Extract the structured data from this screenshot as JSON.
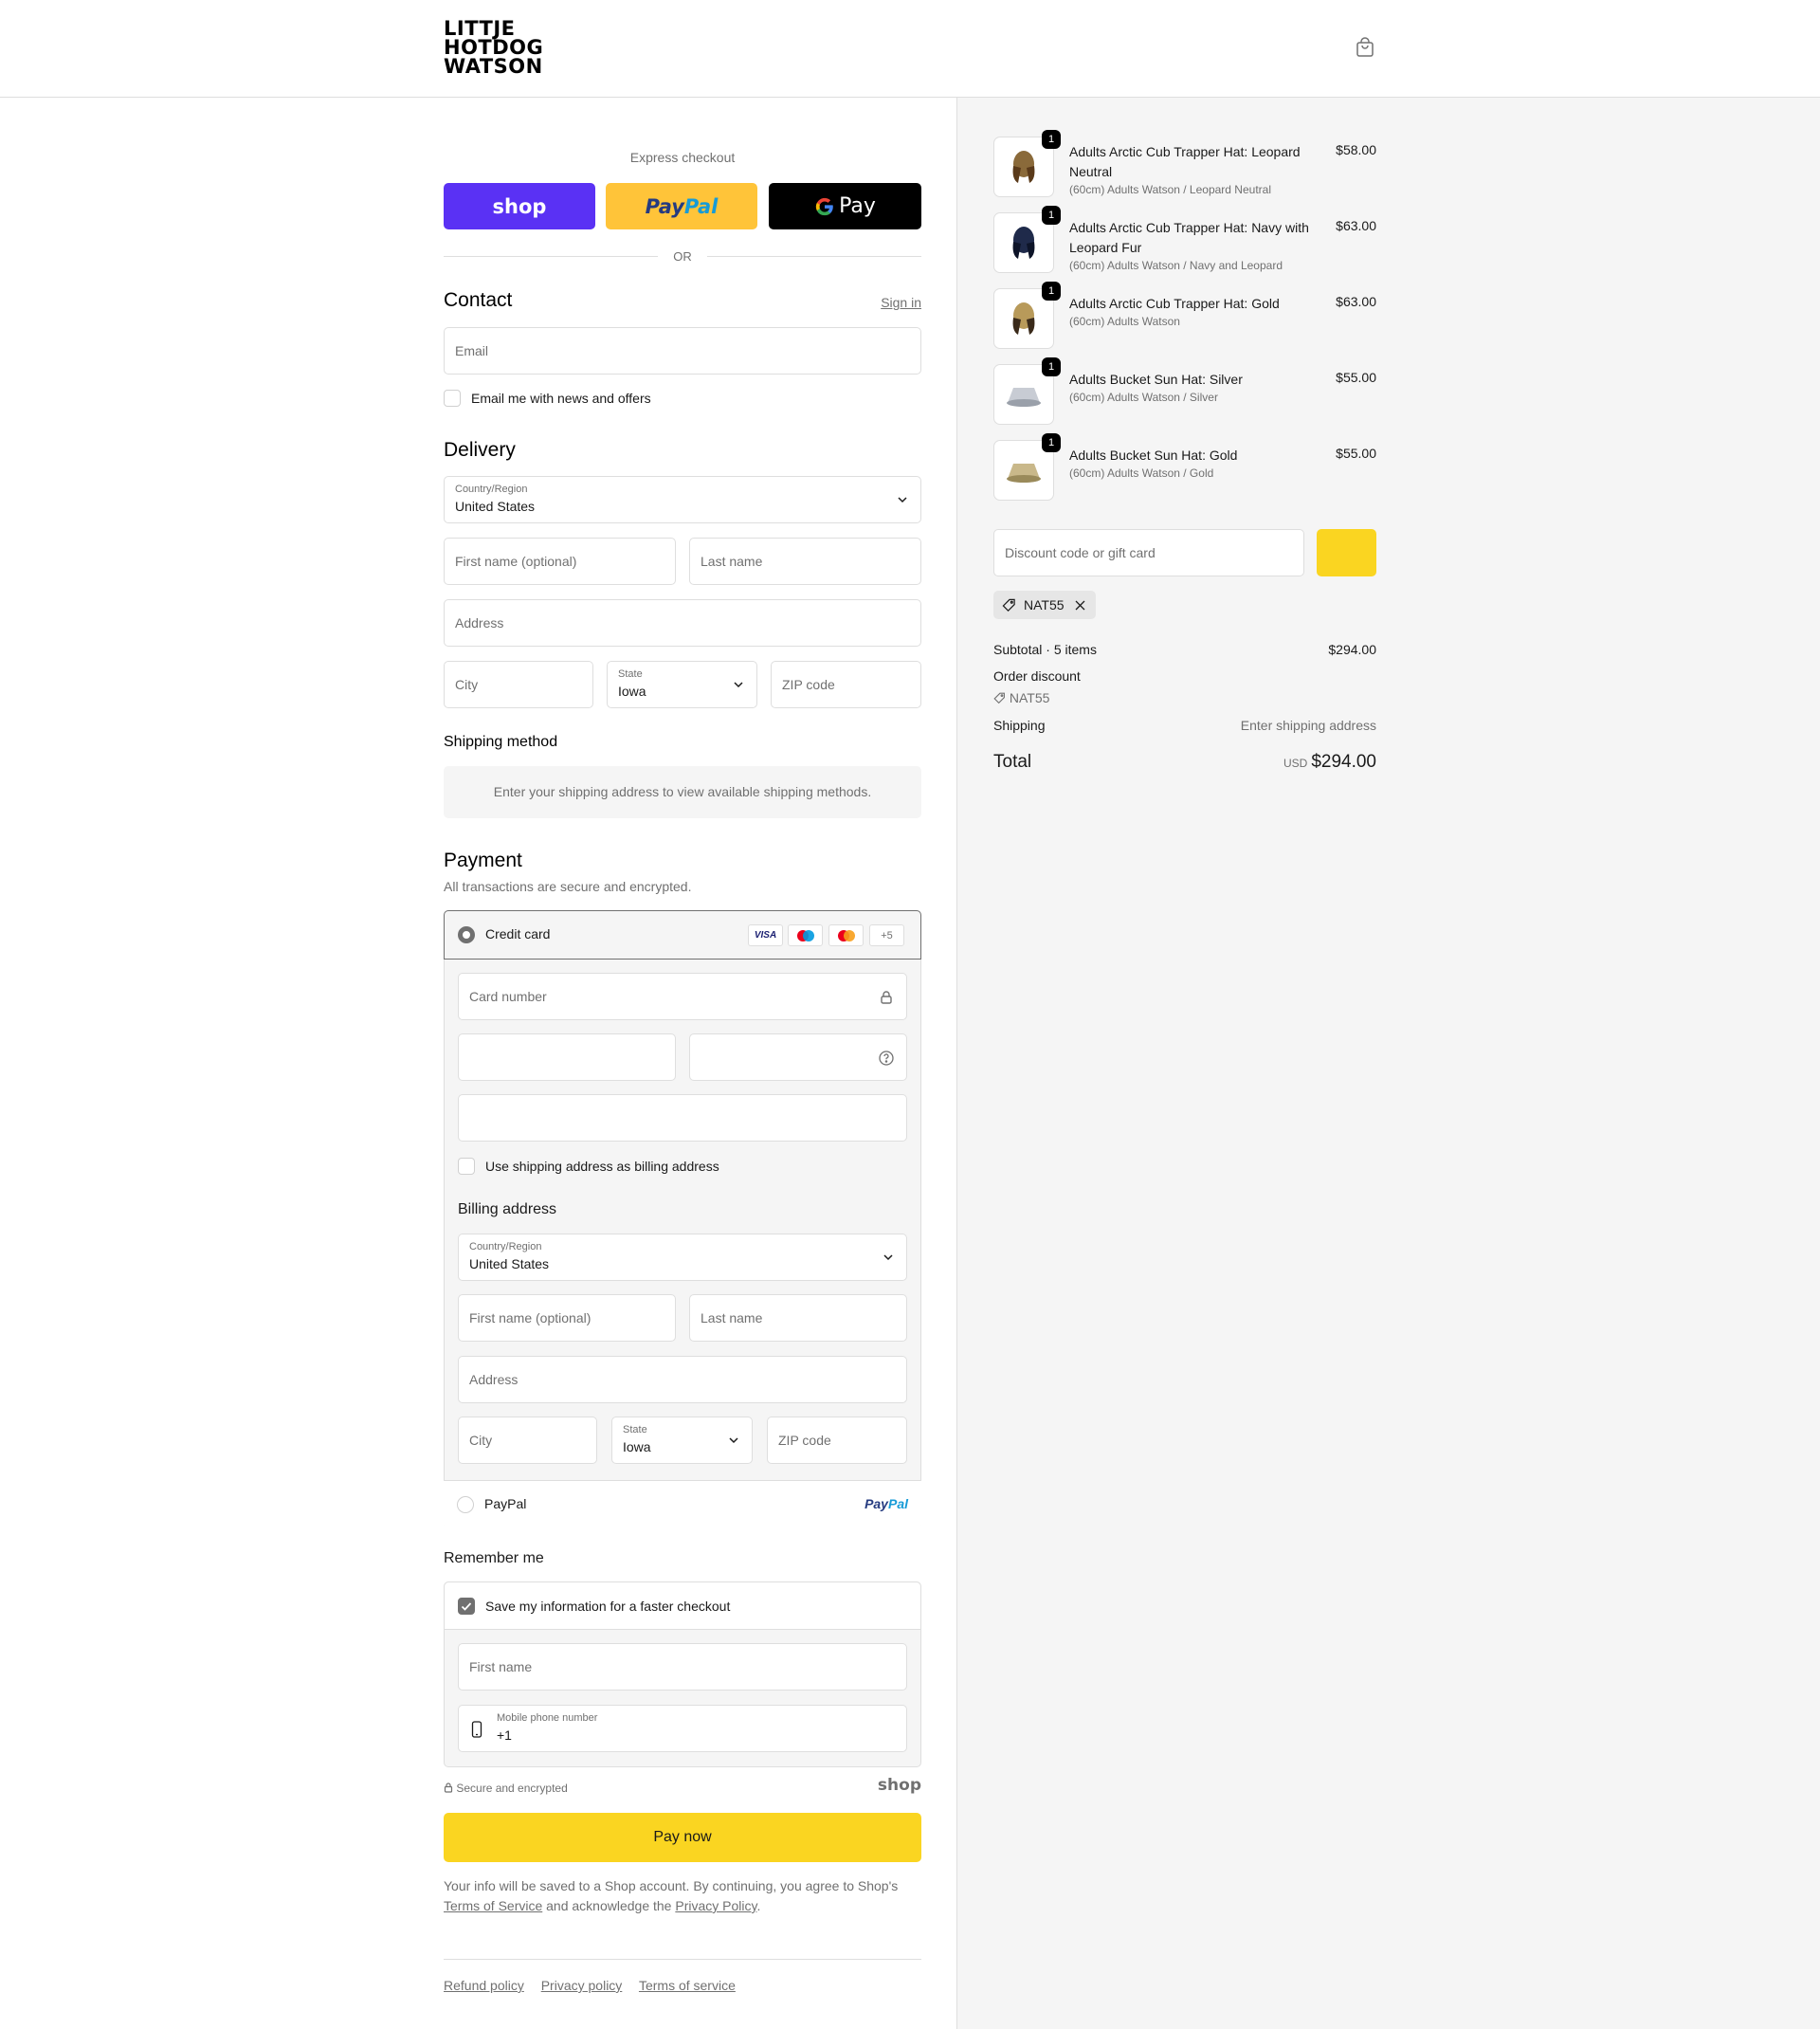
{
  "header": {
    "logo_lines": [
      "LITTJE",
      "HOTDOG",
      "WATSON"
    ],
    "cart_icon": "shopping-bag-icon"
  },
  "express": {
    "label": "Express checkout",
    "shop_label": "shop",
    "paypal_part1": "Pay",
    "paypal_part2": "Pal",
    "gpay_label": "Pay",
    "or_label": "OR"
  },
  "contact": {
    "title": "Contact",
    "sign_in": "Sign in",
    "email_placeholder": "Email",
    "news_label": "Email me with news and offers"
  },
  "delivery": {
    "title": "Delivery",
    "country_label": "Country/Region",
    "country_value": "United States",
    "first_name_placeholder": "First name (optional)",
    "last_name_placeholder": "Last name",
    "address_placeholder": "Address",
    "city_placeholder": "City",
    "state_label": "State",
    "state_value": "Iowa",
    "zip_placeholder": "ZIP code"
  },
  "shipping": {
    "title": "Shipping method",
    "message": "Enter your shipping address to view available shipping methods."
  },
  "payment": {
    "title": "Payment",
    "subtitle": "All transactions are secure and encrypted.",
    "credit_card_label": "Credit card",
    "card_badges": [
      "VISA",
      "",
      "",
      "+5"
    ],
    "card_number_placeholder": "Card number",
    "use_shipping_label": "Use shipping address as billing address",
    "billing_title": "Billing address",
    "billing_country_label": "Country/Region",
    "billing_country_value": "United States",
    "billing_first_placeholder": "First name (optional)",
    "billing_last_placeholder": "Last name",
    "billing_address_placeholder": "Address",
    "billing_city_placeholder": "City",
    "billing_state_label": "State",
    "billing_state_value": "Iowa",
    "billing_zip_placeholder": "ZIP code",
    "paypal_label": "PayPal",
    "paypal_logo_part1": "Pay",
    "paypal_logo_part2": "Pal"
  },
  "remember": {
    "title": "Remember me",
    "save_label": "Save my information for a faster checkout",
    "first_name_placeholder": "First name",
    "phone_label": "Mobile phone number",
    "phone_value": "+1",
    "secure_label": "Secure and encrypted",
    "shop_logo": "shop"
  },
  "pay_now": "Pay now",
  "legal": {
    "text1": "Your info will be saved to a Shop account. By continuing, you agree to Shop's",
    "terms": "Terms of Service",
    "text2": "and acknowledge the",
    "privacy": "Privacy Policy",
    "text3": "."
  },
  "footer": {
    "links": [
      "Refund policy",
      "Privacy policy",
      "Terms of service"
    ]
  },
  "order": {
    "items": [
      {
        "qty": "1",
        "name": "Adults Arctic Cub Trapper Hat: Leopard Neutral",
        "variant": "(60cm) Adults Watson / Leopard Neutral",
        "price": "$58.00",
        "color": "#8a6a3a",
        "accent": "#5a3a1a"
      },
      {
        "qty": "1",
        "name": "Adults Arctic Cub Trapper Hat: Navy with Leopard Fur",
        "variant": "(60cm) Adults Watson / Navy and Leopard",
        "price": "$63.00",
        "color": "#1f2a4a",
        "accent": "#0d1428"
      },
      {
        "qty": "1",
        "name": "Adults Arctic Cub Trapper Hat: Gold",
        "variant": "(60cm) Adults Watson",
        "price": "$63.00",
        "color": "#b89a5a",
        "accent": "#3a2a1a"
      },
      {
        "qty": "1",
        "name": "Adults Bucket Sun Hat: Silver",
        "variant": "(60cm) Adults Watson / Silver",
        "price": "$55.00",
        "color": "#c8ccd4",
        "accent": "#9aa0aa"
      },
      {
        "qty": "1",
        "name": "Adults Bucket Sun Hat: Gold",
        "variant": "(60cm) Adults Watson / Gold",
        "price": "$55.00",
        "color": "#c9b88a",
        "accent": "#9a8a5a"
      }
    ],
    "discount_placeholder": "Discount code or gift card",
    "applied_code": "NAT55",
    "subtotal_label": "Subtotal · 5 items",
    "subtotal_value": "$294.00",
    "order_discount_label": "Order discount",
    "order_discount_code": "NAT55",
    "shipping_label": "Shipping",
    "shipping_value": "Enter shipping address",
    "total_label": "Total",
    "currency": "USD",
    "total_value": "$294.00"
  },
  "colors": {
    "accent_yellow": "#fad521",
    "shop_purple": "#5a31f4",
    "paypal_yellow": "#ffc439"
  }
}
